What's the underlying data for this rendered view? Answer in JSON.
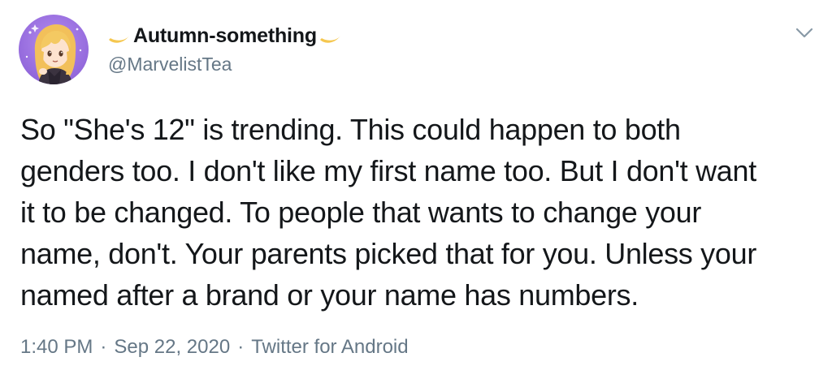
{
  "user": {
    "display_name": "Autumn-something",
    "handle": "@MarvelistTea",
    "name_decoration_icon": "crescent-moon-icon",
    "avatar_icon": "anime-girl-avatar"
  },
  "tweet": {
    "text_lines": [
      "So \"She's 12\" is trending. This could happen to both",
      "genders too. I don't like my first name too. But I don't want",
      "it to be changed. To people that wants to change your",
      "name, don't. Your parents picked that for you. Unless your",
      "named after a brand or your name has numbers."
    ]
  },
  "meta": {
    "time": "1:40 PM",
    "separator": "·",
    "date": "Sep 22, 2020",
    "source": "Twitter for Android"
  },
  "menu": {
    "icon": "chevron-down-icon"
  },
  "colors": {
    "primary_text": "#14171a",
    "secondary_text": "#657786",
    "moon": "#f5c74f",
    "avatar_bg": "#9b6fe0"
  }
}
